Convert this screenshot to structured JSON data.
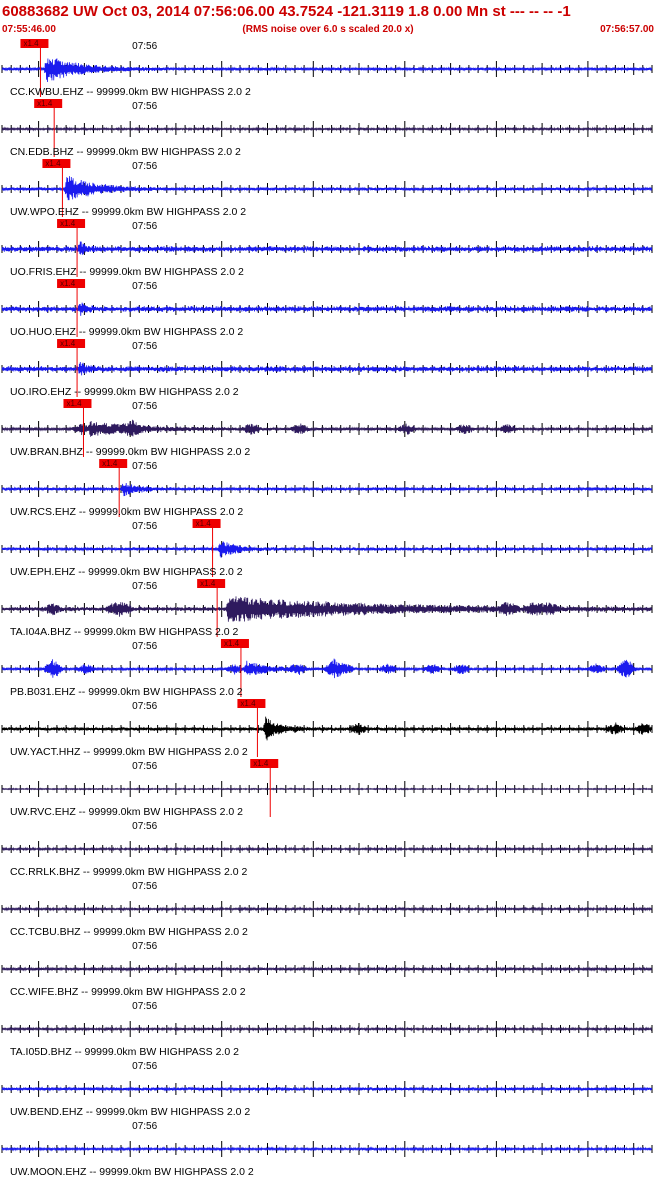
{
  "header": {
    "title": "60883682 UW Oct 03, 2014 07:56:06.00   43.7524 -121.3119  1.8 0.00 Mn st --- -- --   -1",
    "start_time": "07:55:46.00",
    "subtitle": "(RMS noise over 6.0 s scaled 20.0 x)",
    "end_time": "07:56:57.00",
    "title_color": "#cc0000"
  },
  "chart_data": {
    "type": "line",
    "title": "60883682 UW Oct 03, 2014 07:56:06.00   43.7524 -121.3119  1.8 0.00 Mn st --- -- --   -1",
    "subtitle": "(RMS noise over 6.0 s scaled 20.0 x)",
    "x_range": [
      "07:55:46.00",
      "07:56:57.00"
    ],
    "x_range_seconds": [
      0,
      71
    ],
    "minute_tick": {
      "label": "07:56",
      "t": 14
    },
    "pick_label": "x1.4",
    "pick_color": "#ee0000",
    "colors": {
      "blue": "#1a1aee",
      "purple": "#2e1a5e",
      "black": "#000000",
      "tick": "#000000"
    },
    "series": [
      {
        "name": "CC.KWBU.EHZ -- 99999.0km BW  HIGHPASS  2.0  2",
        "color": "blue",
        "pick": 4.2,
        "arrival": 4.6,
        "noise": 0.11,
        "event": 1.0,
        "decay": 3.5,
        "bursts": 0,
        "seed": 11
      },
      {
        "name": "CN.EDB.BHZ -- 99999.0km BW  HIGHPASS  2.0  2",
        "color": "purple",
        "pick": 5.7,
        "arrival": null,
        "noise": 0.08,
        "event": 0,
        "decay": 2,
        "bursts": 0,
        "seed": 12
      },
      {
        "name": "UW.WPO.EHZ -- 99999.0km BW  HIGHPASS  2.0  2",
        "color": "blue",
        "pick": 6.6,
        "arrival": 6.8,
        "noise": 0.13,
        "event": 1.0,
        "decay": 3.0,
        "bursts": 0,
        "seed": 13
      },
      {
        "name": "UO.FRIS.EHZ -- 99999.0km BW  HIGHPASS  2.0  2",
        "color": "blue",
        "pick": 8.2,
        "arrival": 8.3,
        "noise": 0.22,
        "event": 0.65,
        "decay": 0.6,
        "bursts": 0,
        "seed": 14
      },
      {
        "name": "UO.HUO.EHZ -- 99999.0km BW  HIGHPASS  2.0  2",
        "color": "blue",
        "pick": 8.2,
        "arrival": 8.3,
        "noise": 0.22,
        "event": 0.65,
        "decay": 0.6,
        "bursts": 0,
        "seed": 15
      },
      {
        "name": "UO.IRO.EHZ -- 99999.0km BW  HIGHPASS  2.0  2",
        "color": "blue",
        "pick": 8.2,
        "arrival": 8.3,
        "noise": 0.22,
        "event": 0.65,
        "decay": 0.6,
        "bursts": 0,
        "seed": 16
      },
      {
        "name": "UW.BRAN.BHZ -- 99999.0km BW  HIGHPASS  2.0  2",
        "color": "purple",
        "pick": 8.9,
        "arrival": 9.4,
        "noise": 0.1,
        "event": 0.5,
        "decay": 6.0,
        "bursts": 7,
        "seed": 17
      },
      {
        "name": "UW.RCS.EHZ -- 99999.0km BW  HIGHPASS  2.0  2",
        "color": "blue",
        "pick": 12.8,
        "arrival": 13.0,
        "noise": 0.13,
        "event": 0.55,
        "decay": 1.5,
        "bursts": 0,
        "seed": 18
      },
      {
        "name": "UW.EPH.EHZ -- 99999.0km BW  HIGHPASS  2.0  2",
        "color": "blue",
        "pick": 23.0,
        "arrival": 23.6,
        "noise": 0.13,
        "event": 0.75,
        "decay": 1.6,
        "bursts": 0,
        "seed": 19
      },
      {
        "name": "TA.I04A.BHZ -- 99999.0km BW  HIGHPASS  2.0  2",
        "color": "purple",
        "pick": 23.5,
        "arrival": 24.4,
        "noise": 0.17,
        "event": 0.85,
        "decay": 14.0,
        "bursts": 6,
        "seed": 20
      },
      {
        "name": "PB.B031.EHZ -- 99999.0km BW  HIGHPASS  2.0  2",
        "color": "blue",
        "pick": 26.1,
        "arrival": 26.4,
        "noise": 0.1,
        "event": 0.6,
        "decay": 2.4,
        "bursts": 14,
        "seed": 21
      },
      {
        "name": "UW.YACT.HHZ -- 99999.0km BW  HIGHPASS  2.0  2",
        "color": "black",
        "pick": 27.9,
        "arrival": 28.5,
        "noise": 0.14,
        "event": 1.0,
        "decay": 1.5,
        "bursts": 3,
        "seed": 22
      },
      {
        "name": "UW.RVC.EHZ -- 99999.0km BW  HIGHPASS  2.0  2",
        "color": "purple",
        "pick": 29.3,
        "arrival": null,
        "noise": 0.05,
        "event": 0,
        "decay": 2,
        "bursts": 0,
        "seed": 23
      },
      {
        "name": "CC.RRLK.BHZ -- 99999.0km BW  HIGHPASS  2.0  2",
        "color": "purple",
        "pick": null,
        "arrival": null,
        "noise": 0.08,
        "event": 0,
        "decay": 2,
        "bursts": 0,
        "seed": 24
      },
      {
        "name": "CC.TCBU.BHZ -- 99999.0km BW  HIGHPASS  2.0  2",
        "color": "purple",
        "pick": null,
        "arrival": null,
        "noise": 0.09,
        "event": 0,
        "decay": 2,
        "bursts": 0,
        "seed": 25
      },
      {
        "name": "CC.WIFE.BHZ -- 99999.0km BW  HIGHPASS  2.0  2",
        "color": "purple",
        "pick": null,
        "arrival": null,
        "noise": 0.1,
        "event": 0,
        "decay": 2,
        "bursts": 0,
        "seed": 26
      },
      {
        "name": "TA.I05D.BHZ -- 99999.0km BW  HIGHPASS  2.0  2",
        "color": "purple",
        "pick": null,
        "arrival": null,
        "noise": 0.09,
        "event": 0,
        "decay": 2,
        "bursts": 0,
        "seed": 27
      },
      {
        "name": "UW.BEND.EHZ -- 99999.0km BW  HIGHPASS  2.0  2",
        "color": "blue",
        "pick": null,
        "arrival": null,
        "noise": 0.13,
        "event": 0,
        "decay": 2,
        "bursts": 0,
        "seed": 28
      },
      {
        "name": "UW.MOON.EHZ -- 99999.0km BW  HIGHPASS  2.0  2",
        "color": "blue",
        "pick": null,
        "arrival": null,
        "noise": 0.09,
        "event": 0,
        "decay": 2,
        "bursts": 0,
        "seed": 29
      }
    ]
  }
}
